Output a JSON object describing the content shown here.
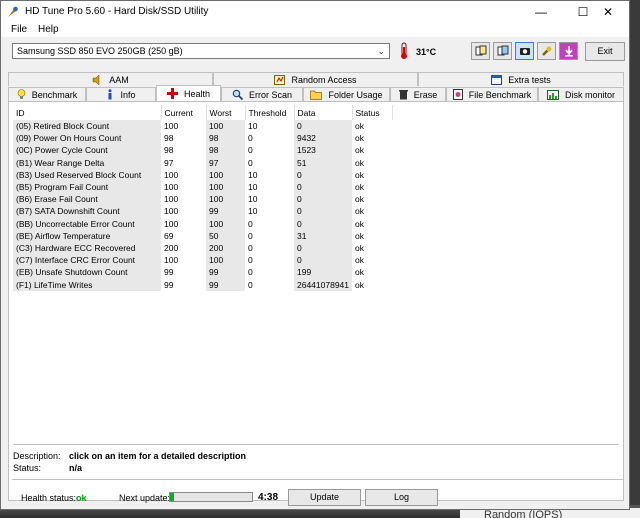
{
  "window": {
    "title": "HD Tune Pro 5.60 - Hard Disk/SSD Utility",
    "min": "—",
    "max": "☐",
    "close": "✕"
  },
  "menu": {
    "file": "File",
    "help": "Help"
  },
  "toolbar": {
    "drive": "Samsung SSD 850 EVO 250GB (250 gB)",
    "temperature": "31°C",
    "exit": "Exit"
  },
  "tabs_top": [
    "AAM",
    "Random Access",
    "Extra tests"
  ],
  "tabs_bottom": [
    "Benchmark",
    "Info",
    "Health",
    "Error Scan",
    "Folder Usage",
    "Erase",
    "File Benchmark",
    "Disk monitor"
  ],
  "table": {
    "headers": [
      "ID",
      "Current",
      "Worst",
      "Threshold",
      "Data",
      "Status"
    ],
    "rows": [
      [
        "(05) Retired Block Count",
        "100",
        "100",
        "10",
        "0",
        "ok"
      ],
      [
        "(09) Power On Hours Count",
        "98",
        "98",
        "0",
        "9432",
        "ok"
      ],
      [
        "(0C) Power Cycle Count",
        "98",
        "98",
        "0",
        "1523",
        "ok"
      ],
      [
        "(B1) Wear Range Delta",
        "97",
        "97",
        "0",
        "51",
        "ok"
      ],
      [
        "(B3) Used Reserved Block Count",
        "100",
        "100",
        "10",
        "0",
        "ok"
      ],
      [
        "(B5) Program Fail Count",
        "100",
        "100",
        "10",
        "0",
        "ok"
      ],
      [
        "(B6) Erase Fail Count",
        "100",
        "100",
        "10",
        "0",
        "ok"
      ],
      [
        "(B7) SATA Downshift Count",
        "100",
        "99",
        "10",
        "0",
        "ok"
      ],
      [
        "(BB) Uncorrectable Error Count",
        "100",
        "100",
        "0",
        "0",
        "ok"
      ],
      [
        "(BE) Airflow Temperature",
        "69",
        "50",
        "0",
        "31",
        "ok"
      ],
      [
        "(C3) Hardware ECC Recovered",
        "200",
        "200",
        "0",
        "0",
        "ok"
      ],
      [
        "(C7) Interface CRC Error Count",
        "100",
        "100",
        "0",
        "0",
        "ok"
      ],
      [
        "(EB) Unsafe Shutdown Count",
        "99",
        "99",
        "0",
        "199",
        "ok"
      ],
      [
        "(F1) LifeTime Writes",
        "99",
        "99",
        "0",
        "26441078941",
        "ok"
      ]
    ]
  },
  "description": {
    "label": "Description:",
    "value": "click on an item for a detailed description",
    "status_label": "Status:",
    "status_value": "n/a"
  },
  "bottom": {
    "health_label": "Health status:",
    "health_value": "ok",
    "next_label": "Next update:",
    "progress_fraction": 0.05,
    "timer": "4:38",
    "update": "Update",
    "log": "Log"
  },
  "background": {
    "app_text": "Random (IOPS)"
  },
  "colors": {
    "ok_green": "#00a000",
    "progress": "#06b025",
    "health_cross": "#d00000"
  }
}
